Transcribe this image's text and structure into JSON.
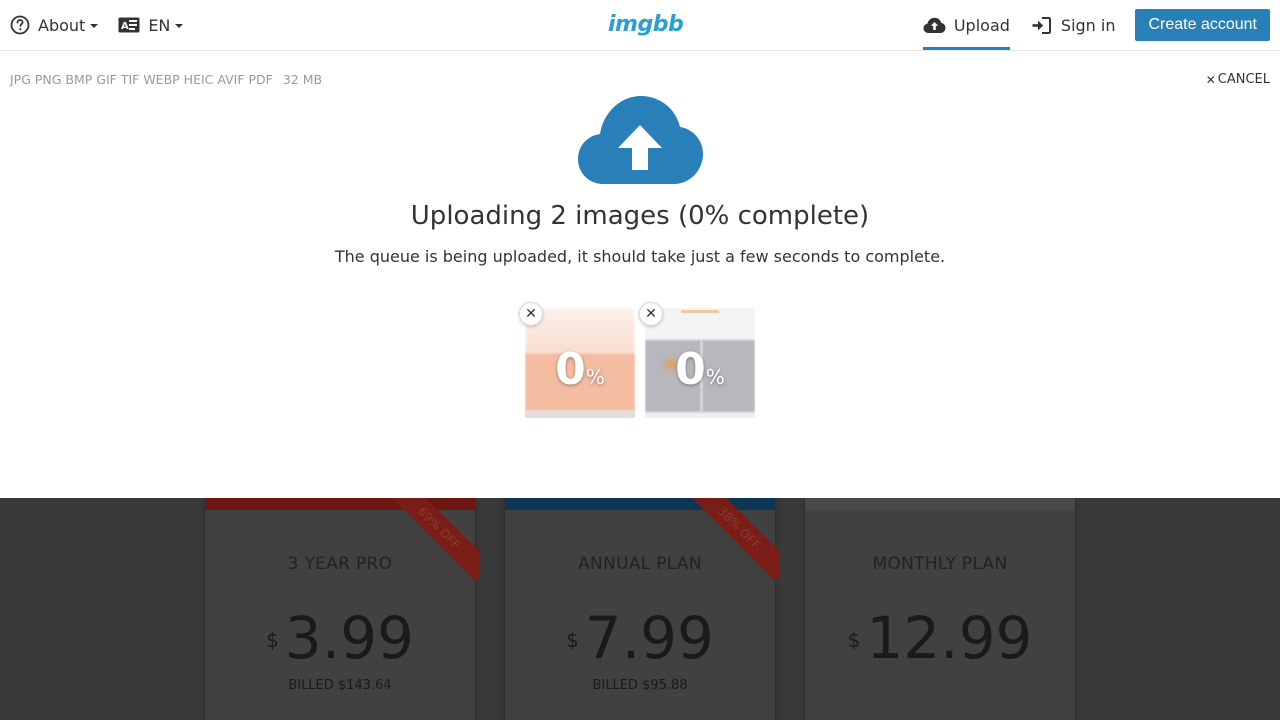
{
  "header": {
    "about_label": "About",
    "language_label": "EN",
    "logo_text": "imgbb",
    "upload_label": "Upload",
    "signin_label": "Sign in",
    "create_account_label": "Create account"
  },
  "upload_panel": {
    "formats": "JPG PNG BMP GIF TIF WEBP HEIC AVIF PDF",
    "max_size": "32 MB",
    "cancel_label": "CANCEL",
    "headline": "Uploading 2 images (0% complete)",
    "subline": "The queue is being uploaded, it should take just a few seconds to complete.",
    "items": [
      {
        "progress_number": "0",
        "progress_symbol": "%",
        "progress_fraction": 0
      },
      {
        "progress_number": "0",
        "progress_symbol": "%",
        "progress_fraction": 0
      }
    ]
  },
  "plans": [
    {
      "title": "3 YEAR PRO",
      "currency": "$",
      "amount": "3.99",
      "billed": "BILLED $143.64",
      "ribbon": "69% OFF"
    },
    {
      "title": "ANNUAL PLAN",
      "currency": "$",
      "amount": "7.99",
      "billed": "BILLED $95.88",
      "ribbon": "38% OFF"
    },
    {
      "title": "MONTHLY PLAN",
      "currency": "$",
      "amount": "12.99"
    }
  ],
  "colors": {
    "accent": "#2980b9",
    "logo": "#2a9fd6",
    "overlay": "#3a3a3a"
  },
  "icons": {
    "about": "question-circle-icon",
    "language": "language-card-icon",
    "upload": "cloud-upload-icon",
    "signin": "sign-in-icon",
    "hero": "cloud-upload-icon",
    "remove": "close-icon"
  }
}
